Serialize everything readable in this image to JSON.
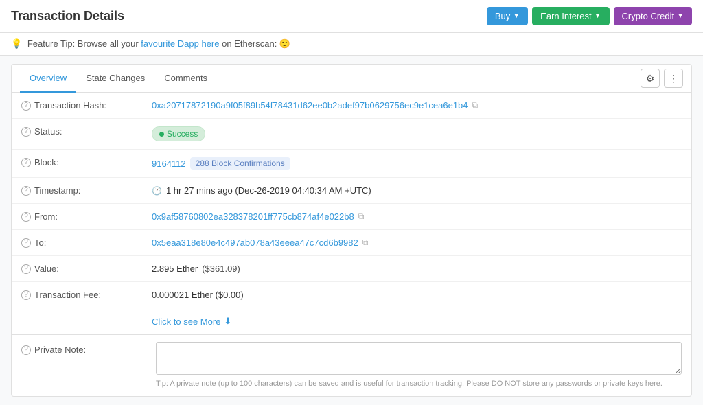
{
  "page": {
    "title": "Transaction Details"
  },
  "header": {
    "buttons": [
      {
        "label": "Buy",
        "variant": "blue"
      },
      {
        "label": "Earn Interest",
        "variant": "green"
      },
      {
        "label": "Crypto Credit",
        "variant": "purple"
      }
    ]
  },
  "featureTip": {
    "prefix": "Feature Tip: Browse all your ",
    "linkText": "favourite Dapp here",
    "suffix": " on Etherscan: 🙂"
  },
  "tabs": {
    "items": [
      {
        "label": "Overview",
        "active": true
      },
      {
        "label": "State Changes",
        "active": false
      },
      {
        "label": "Comments",
        "active": false
      }
    ]
  },
  "details": {
    "rows": [
      {
        "id": "transaction-hash",
        "label": "Transaction Hash:",
        "value": "0xa20717872190a9f05f89b54f78431d62ee0b2adef97b0629756ec9e1cea6e1b4",
        "type": "hash-copy"
      },
      {
        "id": "status",
        "label": "Status:",
        "value": "Success",
        "type": "status"
      },
      {
        "id": "block",
        "label": "Block:",
        "blockNumber": "9164112",
        "confirmations": "288 Block Confirmations",
        "type": "block"
      },
      {
        "id": "timestamp",
        "label": "Timestamp:",
        "value": "1 hr 27 mins ago (Dec-26-2019 04:40:34 AM +UTC)",
        "type": "timestamp"
      },
      {
        "id": "from",
        "label": "From:",
        "value": "0x9af58760802ea328378201ff775cb874af4e022b8",
        "type": "address-copy"
      },
      {
        "id": "to",
        "label": "To:",
        "value": "0x5eaa318e80e4c497ab078a43eeea47c7cd6b9982",
        "type": "address-copy"
      },
      {
        "id": "value",
        "label": "Value:",
        "amount": "2.895 Ether",
        "usd": "($361.09)",
        "type": "value"
      },
      {
        "id": "transaction-fee",
        "label": "Transaction Fee:",
        "amount": "0.000021 Ether ($0.00)",
        "type": "fee"
      }
    ],
    "clickMore": "Click to see More",
    "privateNoteLabel": "Private Note:",
    "privateNotePlaceholder": "",
    "privateNoteTip": "Tip: A private note (up to 100 characters) can be saved and is useful for transaction tracking. Please DO NOT store any passwords or private keys here."
  },
  "icons": {
    "copy": "⧉",
    "clock": "🕐",
    "gear": "⚙",
    "dots": "⋮",
    "chevronDown": "▼",
    "chevronBlue": "⬇",
    "questionMark": "?"
  }
}
